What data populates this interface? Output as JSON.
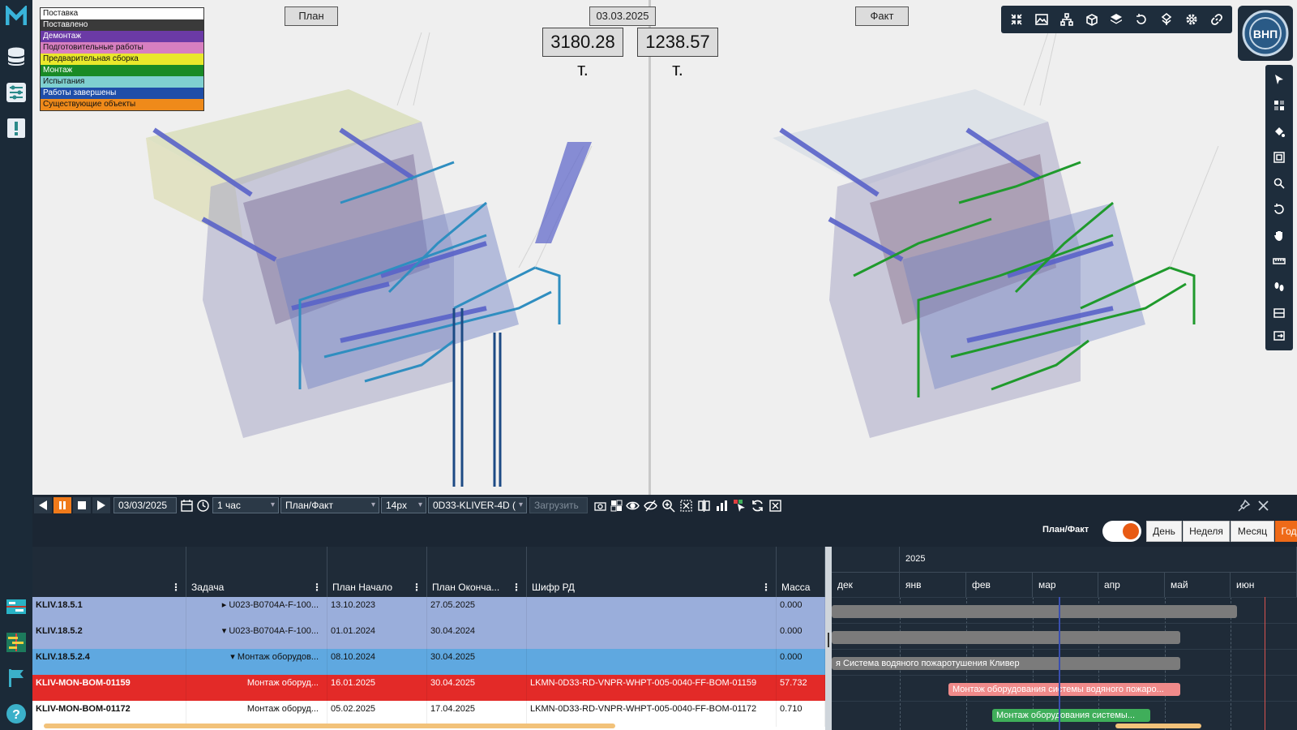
{
  "legend": [
    {
      "label": "Поставка",
      "bg": "#ffffff",
      "fg": "#111111"
    },
    {
      "label": "Поставлено",
      "bg": "#3a3a3a",
      "fg": "#ffffff"
    },
    {
      "label": "Демонтаж",
      "bg": "#6b3aa6",
      "fg": "#ffffff"
    },
    {
      "label": "Подготовительные работы",
      "bg": "#d77fc0",
      "fg": "#111111"
    },
    {
      "label": "Предварительная сборка",
      "bg": "#e9e82b",
      "fg": "#111111"
    },
    {
      "label": "Монтаж",
      "bg": "#198a25",
      "fg": "#ffffff"
    },
    {
      "label": "Испытания",
      "bg": "#7fd0d0",
      "fg": "#111111"
    },
    {
      "label": "Работы завершены",
      "bg": "#1f4ea8",
      "fg": "#ffffff"
    },
    {
      "label": "Существующие объекты",
      "bg": "#ef8a1a",
      "fg": "#111111"
    }
  ],
  "viewports": {
    "plan_label": "План",
    "fact_label": "Факт",
    "date": "03.03.2025",
    "plan_mass": "3180.28 т.",
    "fact_mass": "1238.57 т."
  },
  "logo": {
    "company_text": "ВНП"
  },
  "playback": {
    "date": "03/03/2025",
    "step": "1 час",
    "mode": "План/Факт",
    "size": "14px",
    "model": "0D33-KLIVER-4D (",
    "load_label": "Загрузить"
  },
  "gantt": {
    "toggle_label": "План/Факт",
    "scales": [
      "День",
      "Неделя",
      "Месяц",
      "Год"
    ],
    "active_scale": "Год"
  },
  "table": {
    "columns": [
      "",
      "Задача",
      "План Начало",
      "План Оконча...",
      "Шифр РД",
      "Масса"
    ],
    "rows": [
      {
        "id": "KLIV.18.5.1",
        "task": "▸ U023-B0704A-F-100...",
        "start": "13.10.2023",
        "end": "27.05.2025",
        "code": "",
        "mass": "0.000",
        "bg": "#9aaedb",
        "fg": "#111111"
      },
      {
        "id": "KLIV.18.5.2",
        "task": "▾ U023-B0704A-F-100...",
        "start": "01.01.2024",
        "end": "30.04.2024",
        "code": "",
        "mass": "0.000",
        "bg": "#9aaedb",
        "fg": "#111111"
      },
      {
        "id": "KLIV.18.5.2.4",
        "task": "▾ Монтаж оборудов...",
        "start": "08.10.2024",
        "end": "30.04.2025",
        "code": "",
        "mass": "0.000",
        "bg": "#5fa8e0",
        "fg": "#111111"
      },
      {
        "id": "KLIV-MON-BOM-01159",
        "task": "Монтаж оборуд...",
        "start": "16.01.2025",
        "end": "30.04.2025",
        "code": "LKMN-0D33-RD-VNPR-WHPT-005-0040-FF-BOM-01159",
        "mass": "57.732",
        "bg": "#e32a28",
        "fg": "#ffffff"
      },
      {
        "id": "KLIV-MON-BOM-01172",
        "task": "Монтаж оборуд...",
        "start": "05.02.2025",
        "end": "17.04.2025",
        "code": "LKMN-0D33-RD-VNPR-WHPT-005-0040-FF-BOM-01172",
        "mass": "0.710",
        "bg": "#ffffff",
        "fg": "#111111"
      }
    ]
  },
  "timeline": {
    "year": "2025",
    "months": [
      "дек",
      "янв",
      "фев",
      "мар",
      "апр",
      "май",
      "июн"
    ],
    "bars": [
      {
        "row": 0,
        "label": "",
        "color": "#7b7b7b"
      },
      {
        "row": 1,
        "label": "",
        "color": "#7b7b7b"
      },
      {
        "row": 2,
        "label": "я Система водяного пожаротушения Кливер",
        "color": "#7b7b7b"
      },
      {
        "row": 3,
        "label": "Монтаж оборудования системы водяного пожаро...",
        "color": "#f08a8a"
      },
      {
        "row": 4,
        "label": "Монтаж оборудования системы...",
        "color": "#3fae5a"
      }
    ]
  }
}
